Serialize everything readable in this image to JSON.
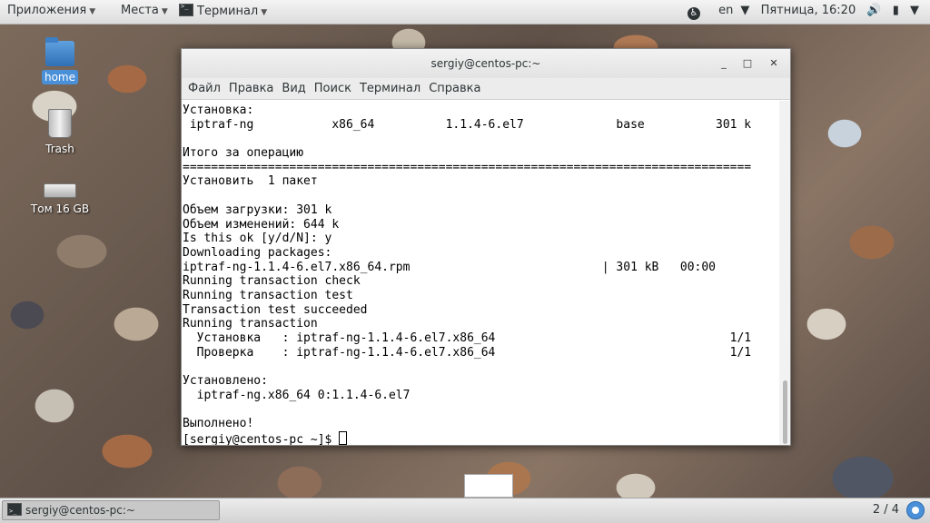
{
  "top_panel": {
    "applications": "Приложения",
    "places": "Места",
    "active_app": "Терминал",
    "lang": "en",
    "clock": "Пятница, 16:20"
  },
  "desktop": {
    "icons": [
      {
        "label": "home"
      },
      {
        "label": "Trash"
      },
      {
        "label": "Том 16 GB"
      }
    ]
  },
  "window": {
    "title": "sergiy@centos-pc:~",
    "menu": [
      "Файл",
      "Правка",
      "Вид",
      "Поиск",
      "Терминал",
      "Справка"
    ]
  },
  "terminal": {
    "lines": [
      "Установка:",
      " iptraf-ng           x86_64          1.1.4-6.el7             base          301 k",
      "",
      "Итого за операцию",
      "================================================================================",
      "Установить  1 пакет",
      "",
      "Объем загрузки: 301 k",
      "Объем изменений: 644 k",
      "Is this ok [y/d/N]: y",
      "Downloading packages:",
      "iptraf-ng-1.1.4-6.el7.x86_64.rpm                           | 301 kB   00:00",
      "Running transaction check",
      "Running transaction test",
      "Transaction test succeeded",
      "Running transaction",
      "  Установка   : iptraf-ng-1.1.4-6.el7.x86_64                                 1/1",
      "  Проверка    : iptraf-ng-1.1.4-6.el7.x86_64                                 1/1",
      "",
      "Установлено:",
      "  iptraf-ng.x86_64 0:1.1.4-6.el7",
      "",
      "Выполнено!"
    ],
    "prompt": "[sergiy@centos-pc ~]$ "
  },
  "bottom_panel": {
    "task": "sergiy@centos-pc:~",
    "workspace": "2 / 4"
  }
}
